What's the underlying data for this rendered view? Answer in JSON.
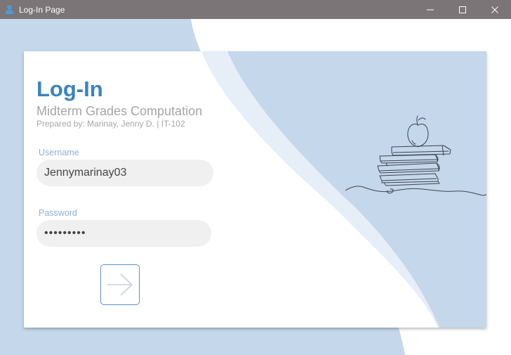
{
  "window": {
    "title": "Log-In Page"
  },
  "login": {
    "heading": "Log-In",
    "subheading": "Midterm Grades Computation",
    "credits": "Prepared by: Marinay, Jenny D. | IT-102",
    "username": {
      "label": "Username",
      "value": "Jennymarinay03"
    },
    "password": {
      "label": "Password",
      "value": "jennymari"
    },
    "submit_icon": "arrow-right-icon"
  },
  "illustration": {
    "subject": "books-apple-line-art"
  },
  "colors": {
    "titlebar": "#7b7577",
    "background_wave": "#c5d7ea",
    "heading": "#3a83c0",
    "muted_text": "#a5a5a5",
    "field_label": "#8cb0d8",
    "field_bg": "#f0f0f0",
    "button_border": "#5c91c2"
  }
}
